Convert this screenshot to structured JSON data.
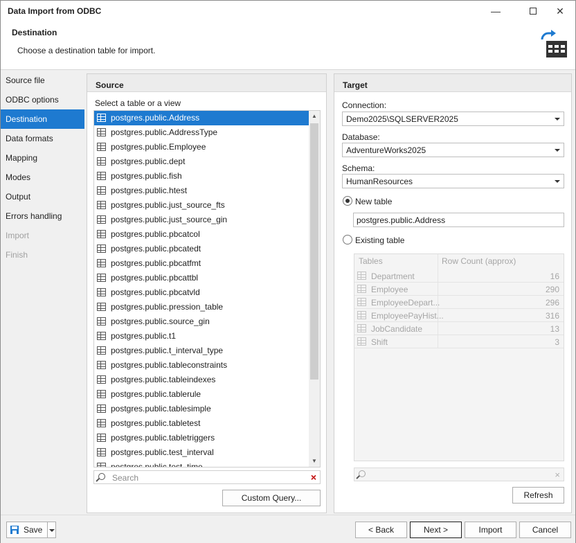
{
  "window": {
    "title": "Data Import from ODBC"
  },
  "header": {
    "title": "Destination",
    "subtitle": "Choose a destination table for import.",
    "icon": "import-table-icon"
  },
  "nav": {
    "items": [
      {
        "label": "Source file",
        "state": "normal"
      },
      {
        "label": "ODBC options",
        "state": "normal"
      },
      {
        "label": "Destination",
        "state": "selected"
      },
      {
        "label": "Data formats",
        "state": "normal"
      },
      {
        "label": "Mapping",
        "state": "normal"
      },
      {
        "label": "Modes",
        "state": "normal"
      },
      {
        "label": "Output",
        "state": "normal"
      },
      {
        "label": "Errors handling",
        "state": "normal"
      },
      {
        "label": "Import",
        "state": "disabled"
      },
      {
        "label": "Finish",
        "state": "disabled"
      }
    ]
  },
  "source": {
    "title": "Source",
    "list_label": "Select a table or a view",
    "tables": [
      "postgres.public.Address",
      "postgres.public.AddressType",
      "postgres.public.Employee",
      "postgres.public.dept",
      "postgres.public.fish",
      "postgres.public.htest",
      "postgres.public.just_source_fts",
      "postgres.public.just_source_gin",
      "postgres.public.pbcatcol",
      "postgres.public.pbcatedt",
      "postgres.public.pbcatfmt",
      "postgres.public.pbcattbl",
      "postgres.public.pbcatvld",
      "postgres.public.pression_table",
      "postgres.public.source_gin",
      "postgres.public.t1",
      "postgres.public.t_interval_type",
      "postgres.public.tableconstraints",
      "postgres.public.tableindexes",
      "postgres.public.tablerule",
      "postgres.public.tablesimple",
      "postgres.public.tabletest",
      "postgres.public.tabletriggers",
      "postgres.public.test_interval",
      "postgres.public.test_time"
    ],
    "selected_index": 0,
    "search_placeholder": "Search",
    "clear_glyph": "×",
    "custom_query_label": "Custom Query..."
  },
  "target": {
    "title": "Target",
    "connection_label": "Connection:",
    "connection_value": "Demo2025\\SQLSERVER2025",
    "database_label": "Database:",
    "database_value": "AdventureWorks2025",
    "schema_label": "Schema:",
    "schema_value": "HumanResources",
    "new_table_label": "New table",
    "new_table_value": "postgres.public.Address",
    "existing_table_label": "Existing table",
    "grid_headers": [
      "Tables",
      "Row Count (approx)"
    ],
    "grid_rows": [
      {
        "name": "Department",
        "count": "16"
      },
      {
        "name": "Employee",
        "count": "290"
      },
      {
        "name": "EmployeeDepart...",
        "count": "296"
      },
      {
        "name": "EmployeePayHist...",
        "count": "316"
      },
      {
        "name": "JobCandidate",
        "count": "13"
      },
      {
        "name": "Shift",
        "count": "3"
      }
    ],
    "refresh_label": "Refresh",
    "clear_glyph": "×"
  },
  "footer": {
    "save_label": "Save",
    "back_label": "< Back",
    "next_label": "Next >",
    "import_label": "Import",
    "cancel_label": "Cancel"
  },
  "colors": {
    "accent": "#1e7ad0"
  }
}
